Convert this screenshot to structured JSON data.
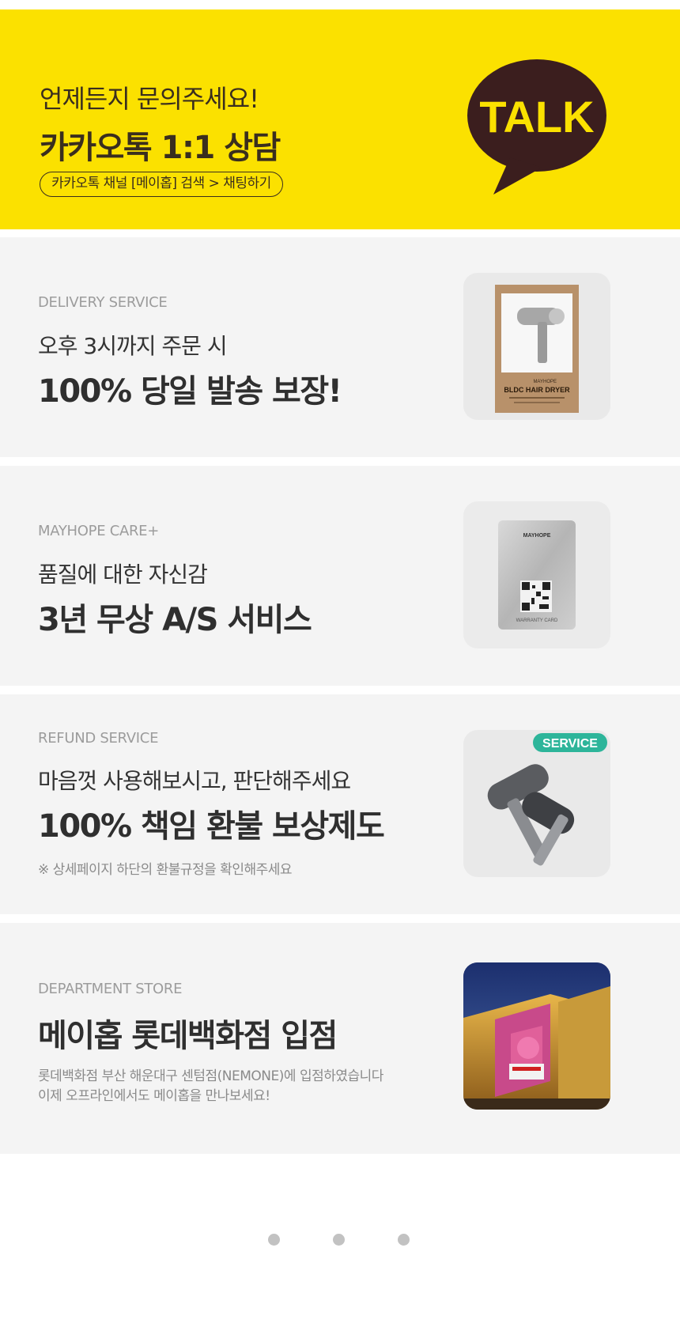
{
  "kakao": {
    "line1": "언제든지 문의주세요!",
    "line2": "카카오톡 1:1 상담",
    "pill": "카카오톡 채널 [메이홉] 검색 > 채팅하기",
    "bubble_text": "TALK",
    "bg_color": "#FBE100",
    "bubble_color": "#3B1E1E"
  },
  "delivery": {
    "eyebrow": "DELIVERY SERVICE",
    "sub": "오후 3시까지 주문 시",
    "headline": "100% 당일 발송 보장!",
    "product_brand": "MAYHOPE",
    "product_name": "BLDC HAIR DRYER"
  },
  "care": {
    "eyebrow": "MAYHOPE CARE+",
    "sub": "품질에 대한 자신감",
    "headline": "3년 무상 A/S 서비스",
    "card_brand": "MAYHOPE",
    "card_label": "WARRANTY CARD"
  },
  "refund": {
    "eyebrow": "REFUND SERVICE",
    "sub": "마음껏 사용해보시고, 판단해주세요",
    "headline": "100% 책임 환불 보상제도",
    "note": "※ 상세페이지 하단의 환불규정을 확인해주세요",
    "badge": "SERVICE",
    "badge_color": "#2DB59A"
  },
  "store": {
    "eyebrow": "DEPARTMENT STORE",
    "headline": "메이홉 롯데백화점 입점",
    "note_line1": "롯데백화점 부산 해운대구 센텀점(NEMONE)에 입점하였습니다",
    "note_line2": "이제 오프라인에서도 메이홉을 만나보세요!"
  },
  "pagination": {
    "count": 3,
    "active_index": 0
  }
}
